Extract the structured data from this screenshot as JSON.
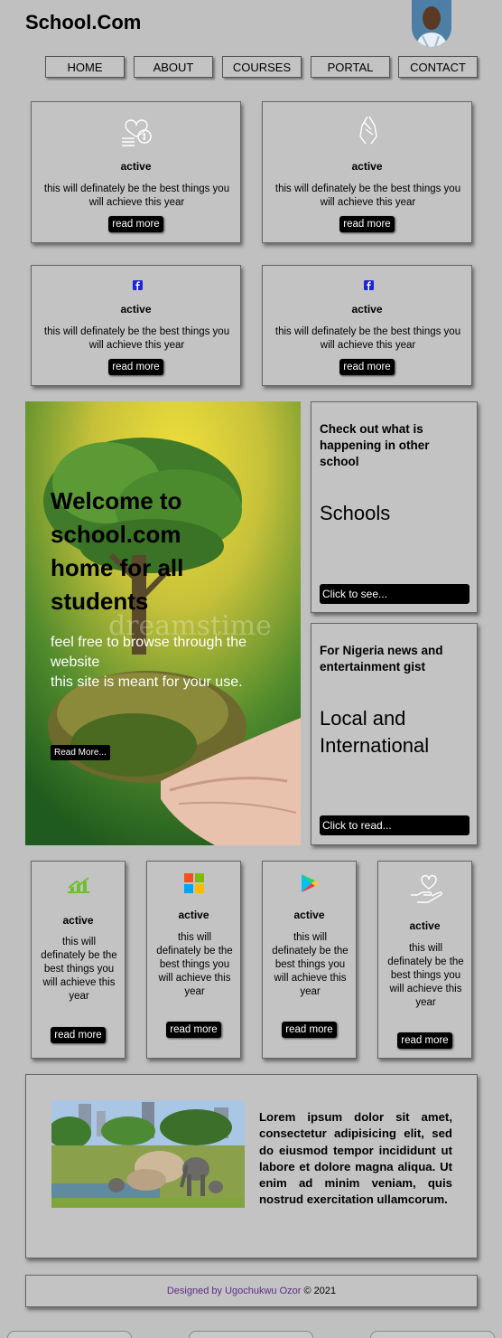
{
  "brand": "School.Com",
  "nav": [
    "HOME",
    "ABOUT",
    "COURSES",
    "PORTAL",
    "CONTACT"
  ],
  "cards_top": [
    {
      "icon": "money-hand-icon",
      "title": "active",
      "desc": "this will definately be the best things you will achieve this year",
      "button": "read more"
    },
    {
      "icon": "praying-hands-icon",
      "title": "active",
      "desc": "this will definately be the best things you will achieve this year",
      "button": "read more"
    },
    {
      "icon": "facebook-icon",
      "title": "active",
      "desc": "this will definately be the best things you will achieve this year",
      "button": "read more"
    },
    {
      "icon": "facebook-icon",
      "title": "active",
      "desc": "this will definately be the best things you will achieve this year",
      "button": "read more"
    }
  ],
  "hero": {
    "title": "Welcome to school.com home for all students",
    "text_line1": "feel free to browse through the website",
    "text_line2": "this site is meant for your use.",
    "button": "Read More...",
    "watermark": "dreamstime"
  },
  "side_panels": [
    {
      "heading": "Check out what is happening in other school",
      "big": "Schools",
      "button": "Click to see..."
    },
    {
      "heading": "For Nigeria news and entertainment gist",
      "big": "Local and International",
      "button": "Click to read..."
    }
  ],
  "cards_small": [
    {
      "icon": "growth-chart-icon",
      "title": "active",
      "desc": "this will definately be the best things you will achieve this year",
      "button": "read more"
    },
    {
      "icon": "windows-logo-icon",
      "title": "active",
      "desc": "this will definately be the best things you will achieve this year",
      "button": "read more"
    },
    {
      "icon": "play-store-icon",
      "title": "active",
      "desc": "this will definately be the best things you will achieve this year",
      "button": "read more"
    },
    {
      "icon": "heart-hand-icon",
      "title": "active",
      "desc": "this will definately be the best things you will achieve this year",
      "button": "read more"
    }
  ],
  "about": {
    "text": "Lorem ipsum dolor sit amet, consectetur adipisicing elit, sed do eiusmod tempor incididunt ut labore et dolore magna aliqua. Ut enim ad minim veniam, quis nostrud exercitation ullamcorum."
  },
  "footer": {
    "prefix": "Designed by ",
    "author": "Ugochukwu Ozor",
    "suffix": " © 2021"
  },
  "colors": {
    "background": "#c0c0c0",
    "button": "#000000",
    "footer_author": "#5b2c8a"
  }
}
